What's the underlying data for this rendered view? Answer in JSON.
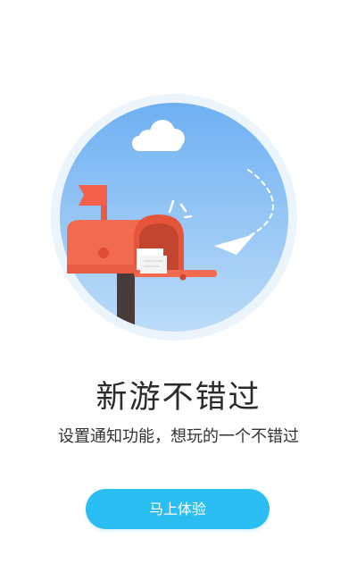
{
  "onboarding": {
    "headline": "新游不错过",
    "subtitle": "设置通知功能，想玩的一个不错过",
    "cta_label": "马上体验"
  },
  "illustration": {
    "elements": [
      "cloud-icon",
      "mailbox-icon",
      "flag-icon",
      "letter-icon",
      "paper-plane-icon"
    ]
  },
  "colors": {
    "accent": "#2bbef2",
    "sky": "#8fc2f4",
    "mailbox": "#f26a4f",
    "headline_text": "#2b2b2b"
  }
}
